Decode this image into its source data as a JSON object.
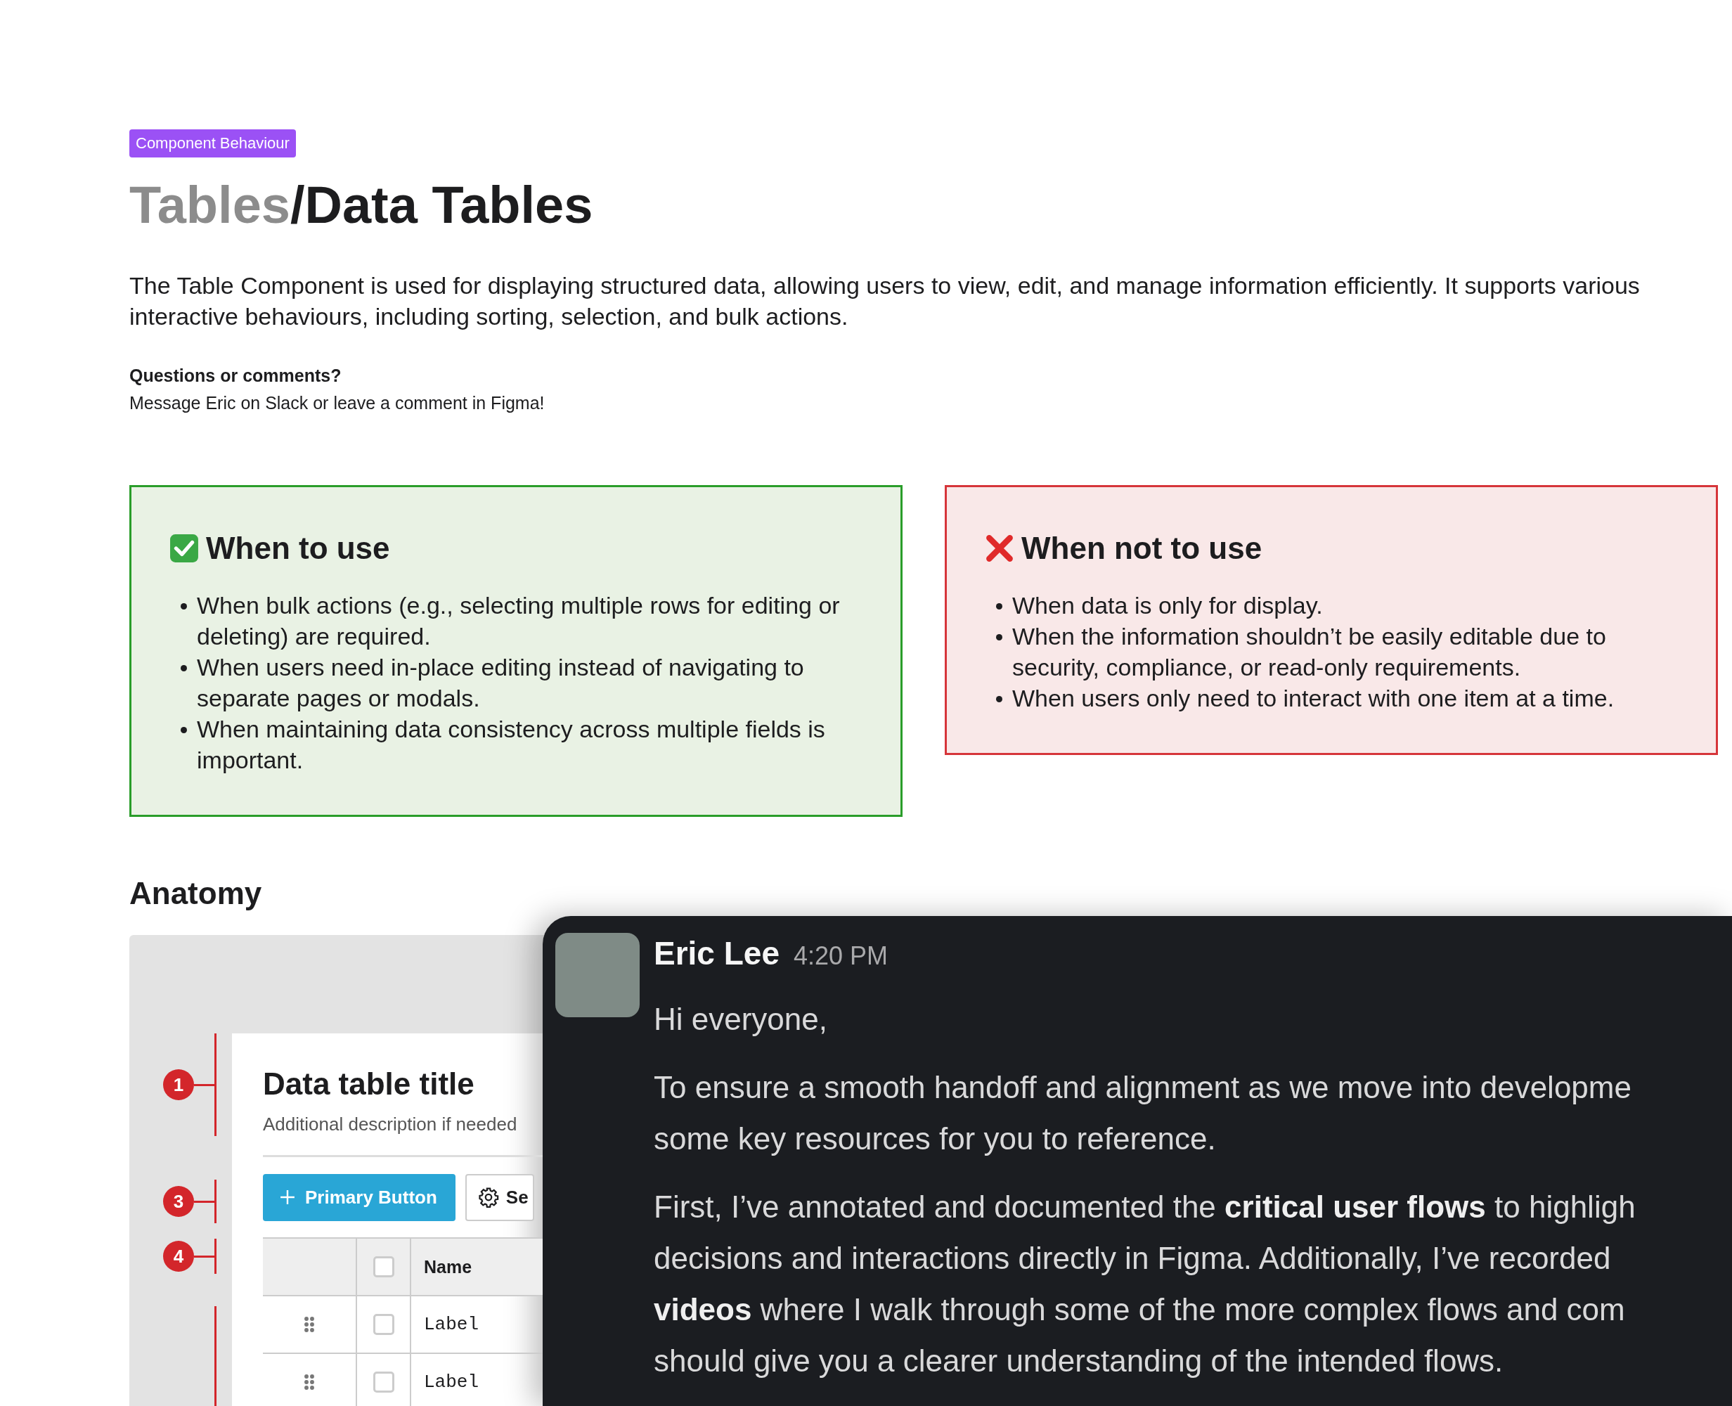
{
  "badge": "Component Behaviour",
  "title": [
    {
      "text": "Tables",
      "muted": true
    },
    {
      "text": "/Data Tables",
      "muted": false
    }
  ],
  "intro": "The Table Component is used for displaying structured data, allowing users to view, edit, and manage information efficiently. It supports various interactive behaviours, including sorting, selection, and bulk actions.",
  "contact": {
    "heading": "Questions or comments?",
    "message": "Message Eric on Slack or leave a comment in Figma!"
  },
  "guidance": [
    {
      "kind": "do",
      "heading": "When to use",
      "items": [
        "When bulk actions (e.g., selecting multiple rows for editing or deleting) are required.",
        "When users need in-place editing instead of navigating to separate pages or modals.",
        "When maintaining data consistency across multiple fields is important."
      ]
    },
    {
      "kind": "dont",
      "heading": "When not to use",
      "items": [
        "When data is only for display.",
        "When the information shouldn’t be easily editable due to security, compliance, or read-only requirements.",
        "When users only need to interact with one item at a time."
      ]
    }
  ],
  "anatomy": {
    "heading": "Anatomy",
    "callouts": [
      "1",
      "3",
      "4"
    ],
    "table": {
      "title": "Data table title",
      "description": "Additional description if needed",
      "primary_button": "Primary Button",
      "secondary_button": "Se",
      "header": {
        "column": "Name",
        "checked": false
      },
      "rows": [
        {
          "label": "Label",
          "checked": false
        },
        {
          "label": "Label",
          "checked": false
        }
      ]
    }
  },
  "chat": {
    "author": "Eric Lee",
    "time": "4:20 PM",
    "paragraphs": [
      {
        "lines": [
          "Hi everyone,"
        ]
      },
      {
        "lines": [
          "To ensure a smooth handoff and alignment as we move into developme",
          "some key resources for you to reference."
        ]
      },
      {
        "lines": [
          "First, I’ve annotated and documented the **critical user flows** to highligh",
          "decisions and interactions directly in Figma. Additionally, I’ve recorded",
          "**videos** where I walk through some of the more complex flows and com",
          "should give you a clearer understanding of the intended flows."
        ]
      }
    ]
  }
}
